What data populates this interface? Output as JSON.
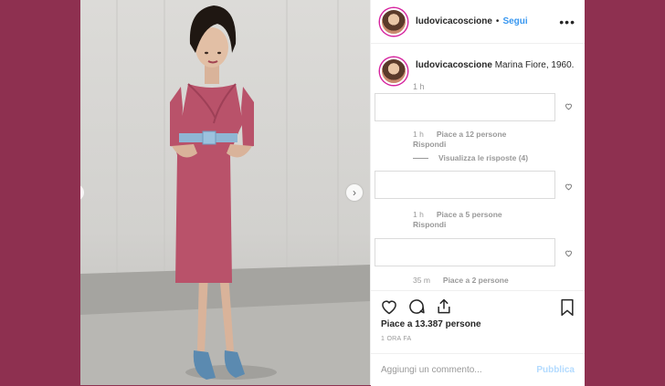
{
  "header": {
    "username": "ludovicacoscione",
    "separator": "•",
    "follow_label": "Segui",
    "more_label": "•••"
  },
  "caption": {
    "username": "ludovicacoscione",
    "text": "Marina Fiore, 1960.",
    "time": "1 h"
  },
  "comments": [
    {
      "time": "1 h",
      "likes": "Piace a 12 persone",
      "reply": "Rispondi",
      "view_replies": "Visualizza le risposte (4)"
    },
    {
      "time": "1 h",
      "likes": "Piace a 5 persone",
      "reply": "Rispondi"
    },
    {
      "time": "35 m",
      "likes": "Piace a 2 persone"
    }
  ],
  "photo": {
    "next_icon": "›"
  },
  "actions": {
    "likes_text": "Piace a 13.387 persone",
    "time_ago": "1 ORA FA",
    "comment_placeholder": "Aggiungi un commento...",
    "publish_label": "Pubblica"
  },
  "icons": {
    "like": "heart-icon",
    "comment": "comment-bubble-icon",
    "share": "share-icon",
    "save": "bookmark-icon",
    "comment_like": "heart-small-icon"
  },
  "colors": {
    "page_background": "#8e3050",
    "link_blue": "#3897f0",
    "publish_disabled": "#b3dbff",
    "dress": "#b9526a",
    "belt": "#8fb6d4"
  }
}
